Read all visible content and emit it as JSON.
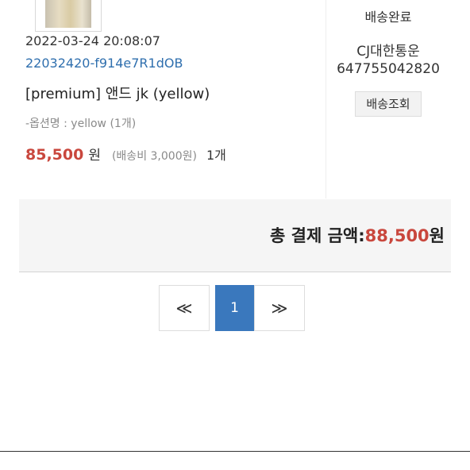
{
  "order": {
    "thumbnail_icon": "product-thumbnail",
    "date": "2022-03-24 20:08:07",
    "order_number": "22032420-f914e7R1dOB",
    "product_name": "[premium] 앤드 jk (yellow)",
    "option": "-옵션명 : yellow (1개)",
    "price": "85,500",
    "currency": "원",
    "shipping_fee": "(배송비 3,000원)",
    "quantity": "1개"
  },
  "delivery": {
    "status": "배송완료",
    "carrier": "CJ대한통운",
    "tracking_number": "647755042820",
    "track_button_label": "배송조회"
  },
  "total": {
    "label": "총 결제 금액:",
    "amount": "88,500",
    "currency": "원"
  },
  "pagination": {
    "prev_label": "≪",
    "current_page": "1",
    "next_label": "≫"
  },
  "colors": {
    "accent_price": "#c9473d",
    "link": "#2f6fae",
    "page_active": "#3a78bd"
  }
}
